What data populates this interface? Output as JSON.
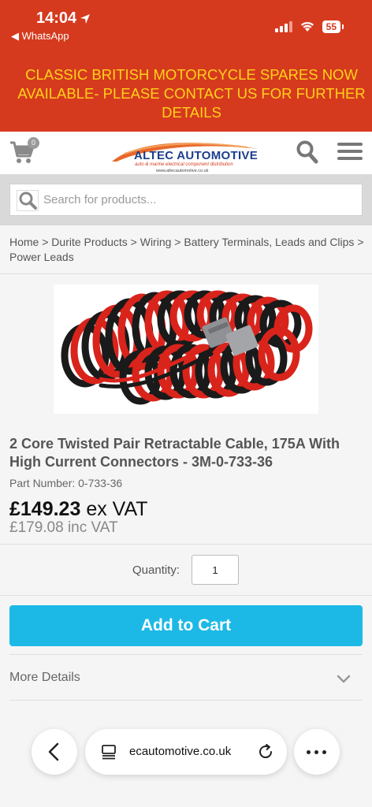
{
  "status_bar": {
    "time": "14:04",
    "back_app": "◀ WhatsApp",
    "battery": "55"
  },
  "announcement": "CLASSIC BRITISH MOTORCYCLE SPARES NOW AVAILABLE- PLEASE CONTACT US FOR FURTHER DETAILS",
  "header": {
    "cart_count": "0",
    "logo_text": "ALTEC AUTOMOTIVE",
    "logo_tagline": "auto & marine electrical component distribution",
    "logo_url": "www.altecautomotive.co.uk"
  },
  "search": {
    "placeholder": "Search for products..."
  },
  "breadcrumb": "Home > Durite Products > Wiring > Battery Terminals, Leads and Clips > Power Leads",
  "product": {
    "title": "2 Core Twisted Pair Retractable Cable, 175A With High Current Connectors - 3M-0-733-36",
    "part_number": "Part Number: 0-733-36",
    "price_ex": "£149.23",
    "price_ex_suffix": " ex VAT",
    "price_inc": "£179.08 inc VAT",
    "quantity_label": "Quantity:",
    "quantity_value": "1",
    "add_to_cart": "Add to Cart",
    "more_details": "More Details"
  },
  "browser": {
    "url": "ecautomotive.co.uk"
  },
  "colors": {
    "banner_red": "#d63a1e",
    "banner_text": "#ffd21a",
    "cart_button": "#1db9e6",
    "logo_blue": "#1d3e8a"
  }
}
